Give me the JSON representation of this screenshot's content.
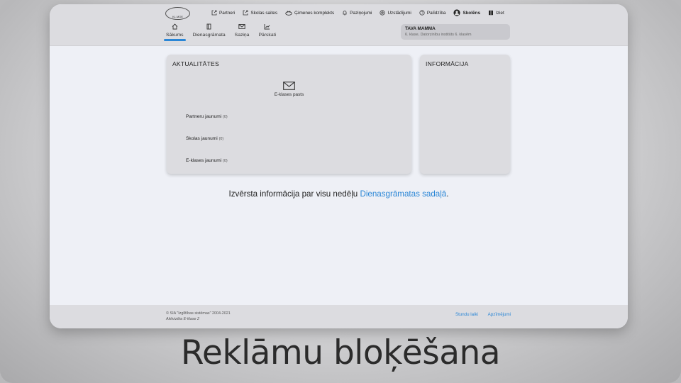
{
  "logo_text": "KL.MOE",
  "topnav": [
    {
      "label": "Partneri",
      "icon": "external-link-icon"
    },
    {
      "label": "Skolas saites",
      "icon": "external-link-icon"
    },
    {
      "label": "Ģimenes komplekts",
      "icon": "family-icon"
    },
    {
      "label": "Paziņojumi",
      "icon": "bell-icon"
    },
    {
      "label": "Uzstādījumi",
      "icon": "gear-icon"
    },
    {
      "label": "Palīdzība",
      "icon": "help-icon"
    },
    {
      "label": "Skolēns",
      "icon": "user-icon"
    },
    {
      "label": "Iziet",
      "icon": "logout-icon"
    }
  ],
  "tabs": [
    {
      "label": "Sākums",
      "icon": "home-icon",
      "active": true
    },
    {
      "label": "Dienasgrāmata",
      "icon": "book-icon"
    },
    {
      "label": "Saziņa",
      "icon": "mail-icon"
    },
    {
      "label": "Pārskati",
      "icon": "chart-icon"
    }
  ],
  "profile": {
    "name": "TAVA MAMMA",
    "sub": "6. klase, Datorzinību institūts 6. klasēm"
  },
  "news": {
    "title": "AKTUALITĀTES",
    "mail_label": "E-klases pasts",
    "items": [
      {
        "label": "Partneru jaunumi",
        "count": "(0)"
      },
      {
        "label": "Skolas jaunumi",
        "count": "(0)"
      },
      {
        "label": "E-klases jaunumi",
        "count": "(0)"
      }
    ]
  },
  "info": {
    "title": "INFORMĀCIJA"
  },
  "notice": {
    "text": "Izvērsta informācija par visu nedēļu",
    "link": "Dienasgrāmatas sadaļā",
    "end": "."
  },
  "footer": {
    "copyright": "© SIA \"Izglītības sistēmas\" 2004-2021",
    "activated": "Aktivizēta E-klase 2",
    "links": [
      "Stundu laiki",
      "Apzīmējumi"
    ]
  },
  "caption": "Reklāmu bloķēšana",
  "colors": {
    "accent": "#2a86d6",
    "header": "#dcdce0",
    "page": "#eef0f6"
  }
}
